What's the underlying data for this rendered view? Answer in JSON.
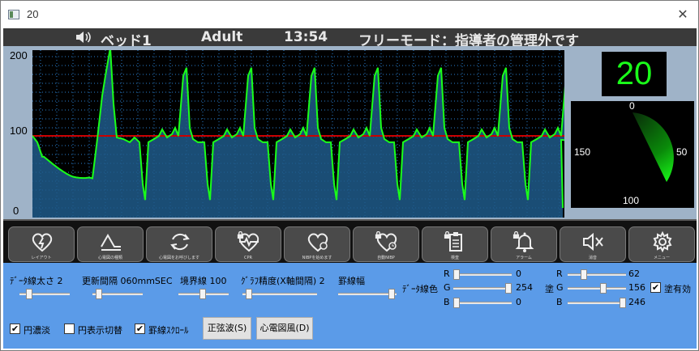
{
  "window": {
    "title": "20",
    "close": "✕"
  },
  "header": {
    "speaker_icon": "speaker-icon",
    "bed": "ベッド1",
    "patient_type": "Adult",
    "time": "13:54",
    "mode": "フリーモード：指導者の管理外です"
  },
  "monitor": {
    "y_labels": [
      "200",
      "100",
      "0"
    ],
    "heart_rate": "20",
    "gauge_labels": {
      "top": "0",
      "left": "150",
      "right": "50",
      "bottom": "100"
    },
    "colors": {
      "trace": "#1aff1a",
      "fill": "#1f5a8a",
      "threshold": "#cc0000",
      "grid": "#2a7fd0"
    }
  },
  "toolbar": {
    "buttons": [
      {
        "label": "レイアウト",
        "icon": "heart-bolt-icon",
        "locked": false
      },
      {
        "label": "心電図の種類",
        "icon": "waveform-icon",
        "locked": false
      },
      {
        "label": "心電図をお呼びします",
        "icon": "refresh-icon",
        "locked": false
      },
      {
        "label": "CPR",
        "icon": "heart-pulse-icon",
        "locked": true
      },
      {
        "label": "NIBPを始めます",
        "icon": "heart-clock-icon",
        "locked": false
      },
      {
        "label": "自動NIBP",
        "icon": "heart-timer-icon",
        "locked": true
      },
      {
        "label": "検査",
        "icon": "clipboard-icon",
        "locked": true
      },
      {
        "label": "アラーム",
        "icon": "bell-icon",
        "locked": true
      },
      {
        "label": "消音",
        "icon": "mute-icon",
        "locked": false
      },
      {
        "label": "メニュー",
        "icon": "gear-icon",
        "locked": false
      }
    ]
  },
  "controls": {
    "line_width_label": "ﾃﾞｰﾀ線太さ 2",
    "update_interval_label": "更新間隔 060mmSEC",
    "threshold_label": "境界線 100",
    "graph_precision_label": "ｸﾞﾗﾌ精度(X軸間隔) 2",
    "grid_width_label": "罫線幅",
    "line_color_label": "ﾃﾞｰﾀ線色",
    "line_color": {
      "r_label": "R",
      "g_label": "G",
      "b_label": "B",
      "r": "0",
      "g": "254",
      "b": "0"
    },
    "fill_label": "塗",
    "fill_color": {
      "r_label": "R",
      "g_label": "G",
      "b_label": "B",
      "r": "62",
      "g": "156",
      "b": "246"
    },
    "fill_enabled_label": "塗有効",
    "fill_enabled": true,
    "circle_shade_label": "円濃淡",
    "circle_shade": true,
    "circle_toggle_label": "円表示切替",
    "circle_toggle": false,
    "grid_scroll_label": "罫線ｽｸﾛｰﾙ",
    "grid_scroll": true,
    "sine_button": "正弦波(S)",
    "ecg_button": "心電図風(D)",
    "check_mark": "✔"
  }
}
